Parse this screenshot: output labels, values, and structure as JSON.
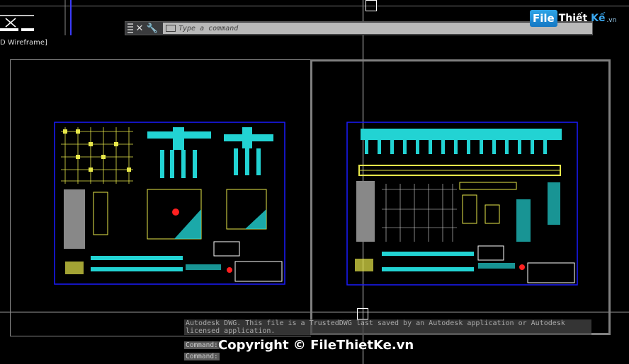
{
  "command_bar": {
    "placeholder": "Type a command",
    "close_icon": "close-icon",
    "customize_icon": "wrench-icon"
  },
  "viewport": {
    "label": "D Wireframe]"
  },
  "watermark_logo": {
    "file": "File",
    "thiet": "Thiết",
    "ke": "Kế",
    "domain": ".vn"
  },
  "history": {
    "text": "Autodesk DWG.  This file is a TrustedDWG last saved by an Autodesk application or Autodesk licensed application."
  },
  "command_lines": [
    "Command:",
    "Command:"
  ],
  "copyright": "Copyright © FileThietKe.vn",
  "colors": {
    "background": "#000000",
    "sheet_border": "#1a1aff",
    "rebar_cyan": "#22d3d3",
    "drawing_yellow": "#e8e84a",
    "marker_red": "#ff2020"
  }
}
